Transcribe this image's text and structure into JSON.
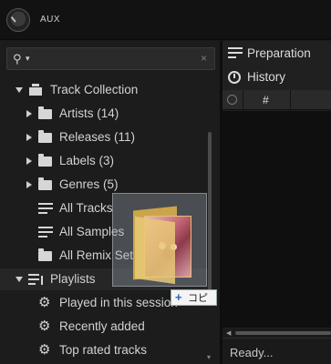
{
  "topbar": {
    "aux_label": "AUX"
  },
  "search": {
    "clear_glyph": "×"
  },
  "tree": [
    {
      "label": "Track Collection",
      "icon": "collection-icon",
      "arrow": "down"
    },
    {
      "label": "Artists (14)",
      "icon": "folder-icon",
      "arrow": "right"
    },
    {
      "label": "Releases (11)",
      "icon": "folder-icon",
      "arrow": "right"
    },
    {
      "label": "Labels (3)",
      "icon": "folder-icon",
      "arrow": "right"
    },
    {
      "label": "Genres (5)",
      "icon": "folder-icon",
      "arrow": "right"
    },
    {
      "label": "All Tracks",
      "icon": "list-icon"
    },
    {
      "label": "All Samples",
      "icon": "list-icon"
    },
    {
      "label": "All Remix Sets",
      "icon": "folder-icon"
    },
    {
      "label": "Playlists",
      "icon": "playlist-icon",
      "arrow": "down"
    },
    {
      "label": "Played in this session",
      "icon": "gear-icon"
    },
    {
      "label": "Recently added",
      "icon": "gear-icon"
    },
    {
      "label": "Top rated tracks",
      "icon": "gear-icon"
    }
  ],
  "right_panel": {
    "preparation_label": "Preparation",
    "history_label": "History",
    "column_hash": "#",
    "status": "Ready..."
  },
  "drag": {
    "copy_label": "コピー",
    "copy_plus": "+"
  }
}
